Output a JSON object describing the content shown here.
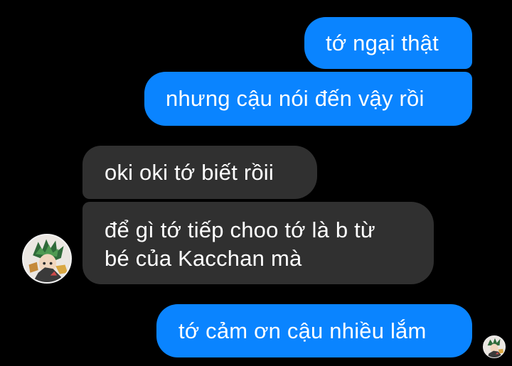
{
  "colors": {
    "background": "#000000",
    "outgoing_bubble": "#0a84ff",
    "incoming_bubble": "#303030",
    "text": "#ffffff"
  },
  "messages": [
    {
      "direction": "outgoing",
      "text": "tớ ngại thật"
    },
    {
      "direction": "outgoing",
      "text": "nhưng cậu nói đến vậy rồi"
    },
    {
      "direction": "incoming",
      "text": "oki oki tớ biết rồii"
    },
    {
      "direction": "incoming",
      "lines": [
        "để gì tớ tiếp choo tớ là b từ",
        "bé của Kacchan mà"
      ]
    },
    {
      "direction": "outgoing",
      "text": "tớ cảm ơn cậu nhiều lắm"
    }
  ],
  "avatars": {
    "contact": "contact-avatar",
    "read_receipt": "read-receipt-avatar"
  }
}
